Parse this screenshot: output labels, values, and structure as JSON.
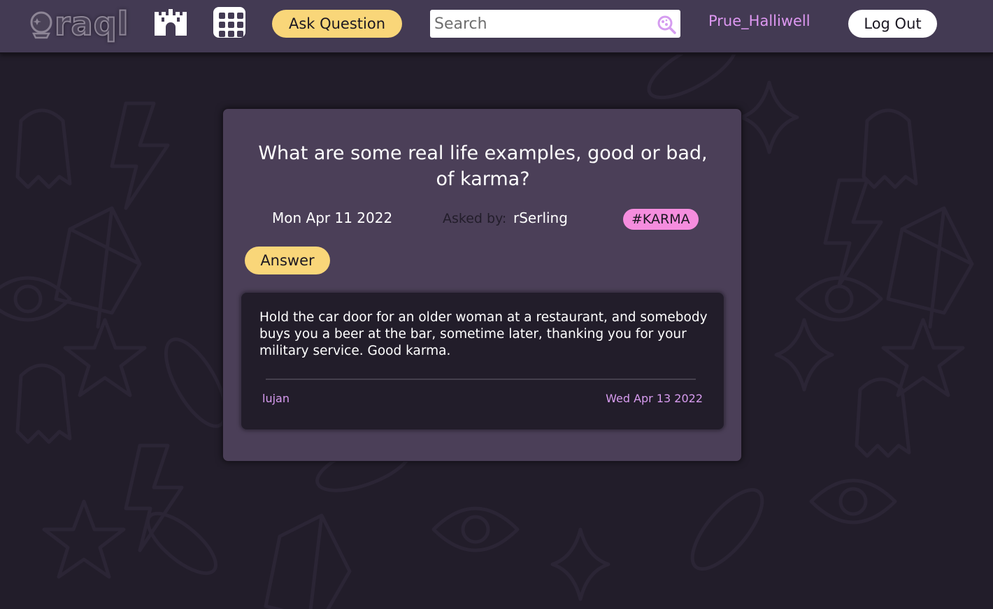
{
  "header": {
    "logo_text": "raql",
    "ask_label": "Ask Question",
    "search_placeholder": "Search",
    "username": "Prue_Halliwell",
    "logout_label": "Log Out",
    "icons": [
      "crystal-ball-icon",
      "castle-icon",
      "grid-icon",
      "search-icon"
    ]
  },
  "question": {
    "title": "What are some real life examples, good or bad, of karma?",
    "date": "Mon Apr 11 2022",
    "asked_by_label": "Asked by:",
    "asked_by": "rSerling",
    "tag": "#KARMA",
    "answer_button": "Answer"
  },
  "answers": [
    {
      "text": "Hold the car door for an older woman at a restaurant, and somebody buys you a beer at the bar, sometime later, thanking you for your military service. Good karma.",
      "author": "lujan",
      "date": "Wed Apr 13 2022"
    }
  ],
  "colors": {
    "header_bg": "#433a53",
    "page_bg": "#221d2a",
    "card_bg": "#4b3f58",
    "accent_yellow": "#f9d679",
    "accent_pink": "#f58dde",
    "accent_purple": "#de98f2"
  }
}
